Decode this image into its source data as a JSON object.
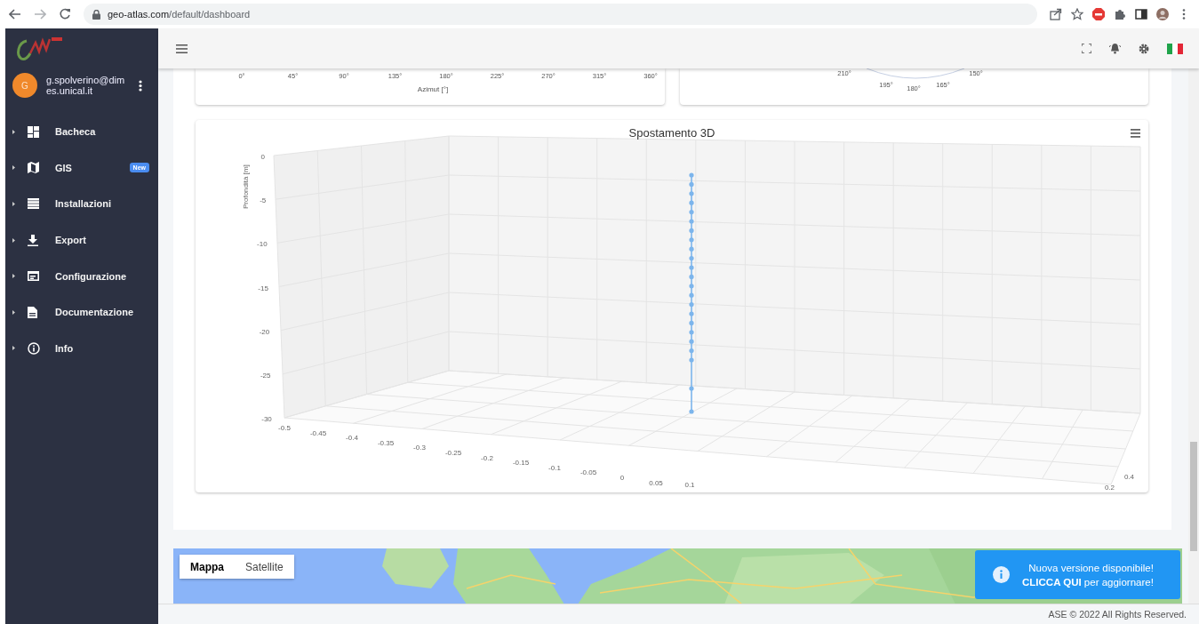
{
  "browser": {
    "url_domain": "geo-atlas.com",
    "url_path": "/default/dashboard"
  },
  "sidebar": {
    "user": {
      "initial": "G",
      "email": "g.spolverino@dimes.unical.it"
    },
    "items": [
      {
        "label": "Bacheca",
        "kind": "dashboard"
      },
      {
        "label": "GIS",
        "kind": "map",
        "badge": "New"
      },
      {
        "label": "Installazioni",
        "kind": "list"
      },
      {
        "label": "Export",
        "kind": "download"
      },
      {
        "label": "Configurazione",
        "kind": "window"
      },
      {
        "label": "Documentazione",
        "kind": "document"
      },
      {
        "label": "Info",
        "kind": "info"
      }
    ]
  },
  "azimuth_chart": {
    "ticks": [
      "0°",
      "45°",
      "90°",
      "135°",
      "180°",
      "225°",
      "270°",
      "315°",
      "360°"
    ],
    "axis_label": "Azimut [°]"
  },
  "polar_chart": {
    "ticks": [
      "210°",
      "195°",
      "180°",
      "165°",
      "150°"
    ]
  },
  "chart_3d": {
    "title": "Spostamento 3D",
    "depth_label": "Profondità [m]",
    "depth_ticks": [
      "0",
      "-5",
      "-10",
      "-15",
      "-20",
      "-25",
      "-30"
    ],
    "x_ticks": [
      "-0.5",
      "-0.45",
      "-0.4",
      "-0.35",
      "-0.3",
      "-0.25",
      "-0.2",
      "-0.15",
      "-0.1",
      "-0.05",
      "0",
      "0.05",
      "0.1"
    ],
    "y_ticks": [
      "0.4",
      "0.2"
    ]
  },
  "map": {
    "types": [
      {
        "label": "Mappa",
        "selected": true
      },
      {
        "label": "Satellite",
        "selected": false
      }
    ]
  },
  "toast": {
    "title": "Nuova versione disponibile!",
    "action": "**CLICCA QUI** per aggiornare!"
  },
  "footer": "ASE © 2022 All Rights Reserved."
}
